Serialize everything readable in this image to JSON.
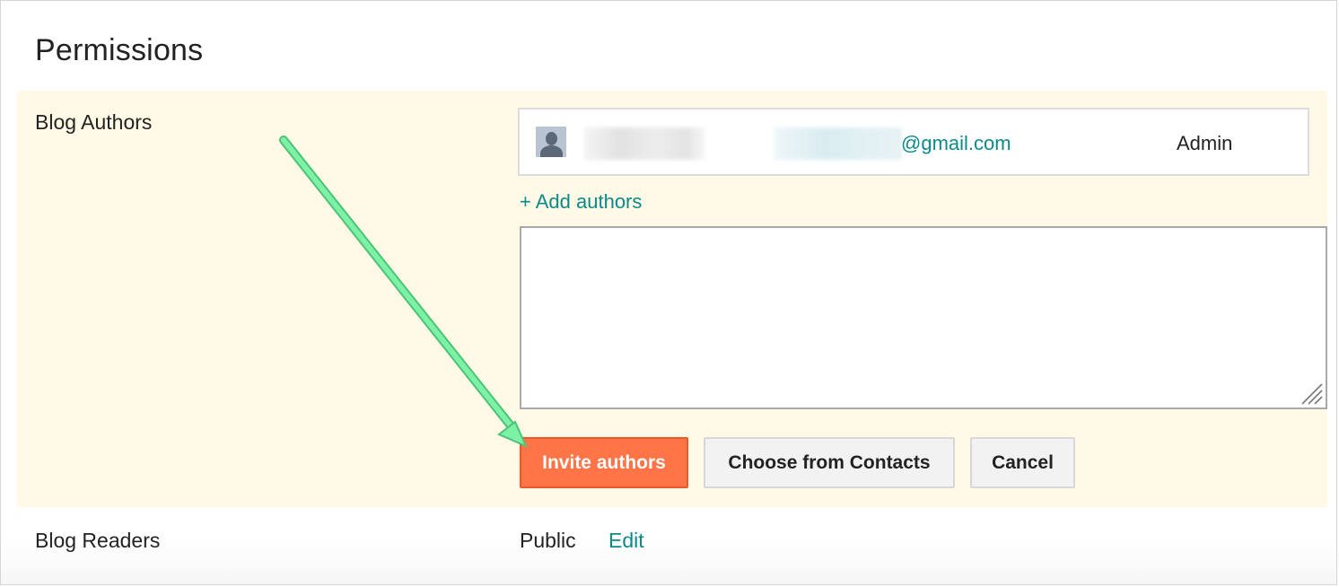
{
  "header": {
    "title": "Permissions"
  },
  "blog_authors": {
    "label": "Blog Authors",
    "authors": [
      {
        "email_domain": "@gmail.com",
        "role": "Admin",
        "avatar_icon": "person-silhouette-icon"
      }
    ],
    "add_authors_link": "+ Add authors",
    "invite_textarea_value": "",
    "buttons": {
      "invite": "Invite authors",
      "choose_contacts": "Choose from Contacts",
      "cancel": "Cancel"
    }
  },
  "blog_readers": {
    "label": "Blog Readers",
    "value": "Public",
    "edit_link": "Edit"
  },
  "colors": {
    "panel_background": "#fff9e6",
    "link": "#0b8a8a",
    "primary_button": "#ff7548",
    "annotation_arrow": "#7ef2a4"
  }
}
